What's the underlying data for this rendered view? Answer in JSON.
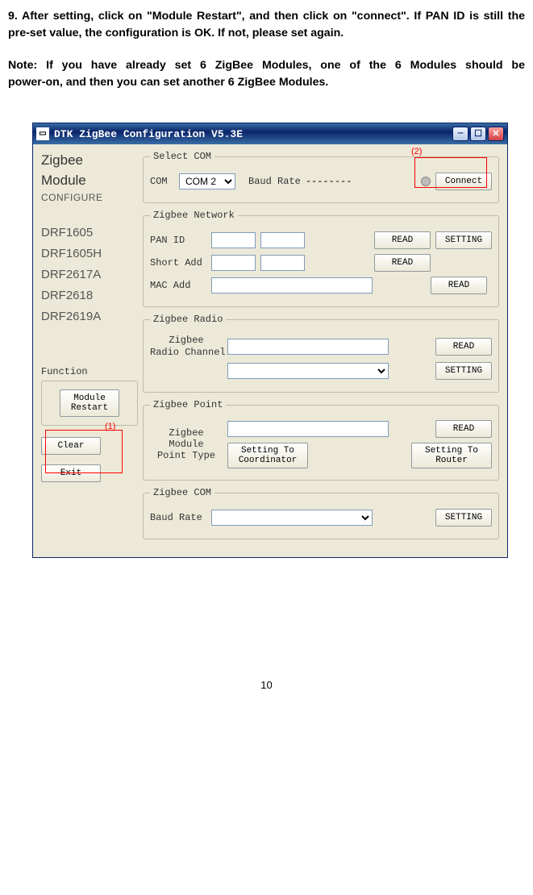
{
  "doc": {
    "para1": "9. After setting, click on \"Module Restart\", and then click on \"connect\". If PAN ID is still the pre-set value, the configuration is OK. If not, please set again.",
    "para2a": "Note: If you have already set 6 ZigBee Modules, one of the 6 Modules should be",
    "para2b": "power-on, and then you can set another 6 ZigBee Modules.",
    "pagenum": "10"
  },
  "callouts": {
    "c1": "(1)",
    "c2": "(2)"
  },
  "app": {
    "title": "DTK ZigBee Configuration V5.3E",
    "left": {
      "head1a": "Zigbee",
      "head1b": "Module",
      "head2": "CONFIGURE",
      "models": [
        "DRF1605",
        "DRF1605H",
        "DRF2617A",
        "DRF2618",
        "DRF2619A"
      ]
    },
    "groups": {
      "selectcom": {
        "legend": "Select COM",
        "comlabel": "COM",
        "comvalue": "COM 2",
        "baudlabel": "Baud Rate",
        "baudvalue": "--------",
        "connect": "Connect"
      },
      "network": {
        "legend": "Zigbee Network",
        "panid": "PAN ID",
        "shortadd": "Short Add",
        "macadd": "MAC Add",
        "read": "READ",
        "setting": "SETTING"
      },
      "radio": {
        "legend": "Zigbee Radio",
        "chlabel": "Zigbee\nRadio Channel",
        "read": "READ",
        "setting": "SETTING"
      },
      "func": {
        "legend": "Function",
        "restart": "Module\nRestart",
        "clear": "Clear",
        "exit": "Exit"
      },
      "point": {
        "legend": "Zigbee Point",
        "ptlabel": "Zigbee\nModule\nPoint Type",
        "read": "READ",
        "coord": "Setting To\nCoordinator",
        "router": "Setting To\nRouter"
      },
      "com": {
        "legend": "Zigbee COM",
        "baud": "Baud Rate",
        "setting": "SETTING"
      }
    }
  }
}
